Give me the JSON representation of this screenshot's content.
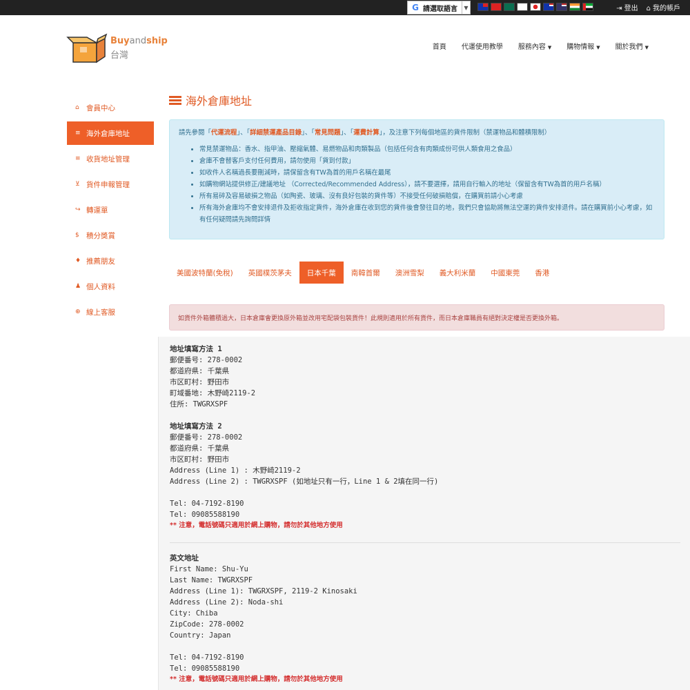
{
  "topbar": {
    "translate_label": "請選取語言",
    "logout": "登出",
    "account": "我的帳戶",
    "flags": [
      "tw-flag",
      "hk-flag",
      "mo-flag",
      "kr-flag",
      "jp-flag",
      "my-flag",
      "us-flag",
      "in-flag",
      "ae-flag"
    ]
  },
  "logo": {
    "brand_a": "Buy",
    "brand_b": "and",
    "brand_c": "ship",
    "region": "台灣"
  },
  "nav": [
    {
      "label": "首頁",
      "dropdown": false
    },
    {
      "label": "代運使用教學",
      "dropdown": false
    },
    {
      "label": "服務內容",
      "dropdown": true
    },
    {
      "label": "購物情報",
      "dropdown": true
    },
    {
      "label": "關於我們",
      "dropdown": true
    }
  ],
  "sidebar": {
    "items": [
      {
        "label": "會員中心",
        "icon": "home-icon",
        "glyph": "⌂"
      },
      {
        "label": "海外倉庫地址",
        "icon": "list-icon",
        "glyph": "≡"
      },
      {
        "label": "收貨地址管理",
        "icon": "list-icon",
        "glyph": "≡"
      },
      {
        "label": "貨件申報管理",
        "icon": "cart-icon",
        "glyph": "⊻"
      },
      {
        "label": "轉運單",
        "icon": "share-icon",
        "glyph": "↪"
      },
      {
        "label": "積分獎賞",
        "icon": "dollar-icon",
        "glyph": "$"
      },
      {
        "label": "推薦朋友",
        "icon": "thumbs-up-icon",
        "glyph": "♦"
      },
      {
        "label": "個人資料",
        "icon": "user-icon",
        "glyph": "♟"
      },
      {
        "label": "線上客服",
        "icon": "lifebuoy-icon",
        "glyph": "⊕"
      }
    ]
  },
  "page_title": "海外倉庫地址",
  "info": {
    "lead_prefix": "請先參閱「",
    "link1": "代運流程",
    "sep1": "」、「",
    "link2": "詳細禁運產品目錄",
    "sep2": "」、「",
    "link3": "常見問題",
    "sep3": "」、「",
    "link4": "運費計算",
    "lead_suffix": "」，及注意下列每個地區的貨件限制（禁運物品和體積限制）",
    "bullets": [
      "常見禁運物品：香水、指甲油、壓縮氣體、易燃物品和肉類製品（包括任何含有肉類成份可供人類食用之食品）",
      "倉庫不會替客戶支付任何費用，請勿使用「貨到付款」",
      "如收件人名稱過長要刪減時，請保留含有TW為首的用戶名稱在最尾",
      "如購物網站提供修正/建議地址 （Corrected/Recommended Address），請不要選擇，請用自行輸入的地址（保留含有TW為首的用戶名稱）",
      "所有易碎及容易破損之物品（如陶瓷、玻璃、沒有良好包裝的貨件等）不接受任何破損賠償，在購買前請小心考慮",
      "所有海外倉庫均不會安排退件及拒收指定貨件，海外倉庫在收到您的貨件後會發往目的地，我們只會協助將無法空運的貨件安排退件。請在購買前小心考慮，如有任何疑問請先詢問詳情"
    ]
  },
  "tabs": [
    {
      "label": "美國波特蘭(免稅)",
      "active": false
    },
    {
      "label": "英國樸茨茅夫",
      "active": false
    },
    {
      "label": "日本千葉",
      "active": true
    },
    {
      "label": "南韓首爾",
      "active": false
    },
    {
      "label": "澳洲雪梨",
      "active": false
    },
    {
      "label": "義大利米蘭",
      "active": false
    },
    {
      "label": "中國東莞",
      "active": false
    },
    {
      "label": "香港",
      "active": false
    }
  ],
  "alert": "如貨件外箱體積過大，日本倉庫會更換原外箱並改用宅配袋包裝貨件！此規則適用於所有貨件，而日本倉庫職員有絕對決定權是否更換外箱。",
  "address": {
    "method1": {
      "heading": "地址填寫方法 1",
      "lines": [
        "郵便番号: 278-0002",
        "都道府県: 千葉県",
        "市区町村: 野田市",
        "町域番地: 木野崎2119-2",
        "住所: TWGRXSPF"
      ]
    },
    "method2": {
      "heading": "地址填寫方法 2",
      "lines": [
        "郵便番号: 278-0002",
        "都道府県: 千葉県",
        "市区町村: 野田市",
        "Address (Line 1) : 木野崎2119-2",
        "Address (Line 2) : TWGRXSPF  (如地址只有一行，Line 1 & 2填在同一行)"
      ],
      "tel": [
        "Tel: 04-7192-8190",
        "Tel: 09085588190"
      ],
      "warning": "** 注意，電話號碼只適用於網上購物，請勿於其他地方使用"
    },
    "english": {
      "heading": "英文地址",
      "lines": [
        "First Name: Shu-Yu",
        "Last Name: TWGRXSPF",
        "Address (Line 1): TWGRXSPF, 2119-2 Kinosaki",
        "Address (Line 2): Noda-shi",
        "City: Chiba",
        "ZipCode: 278-0002",
        "Country: Japan"
      ],
      "tel": [
        "Tel: 04-7192-8190",
        "Tel: 09085588190"
      ],
      "warning": "** 注意，電話號碼只適用於網上購物，請勿於其他地方使用"
    }
  },
  "colors": {
    "accent": "#ee5f28",
    "info_bg": "#d9edf7",
    "alert_bg": "#f2dede",
    "topbar": "#222222"
  }
}
